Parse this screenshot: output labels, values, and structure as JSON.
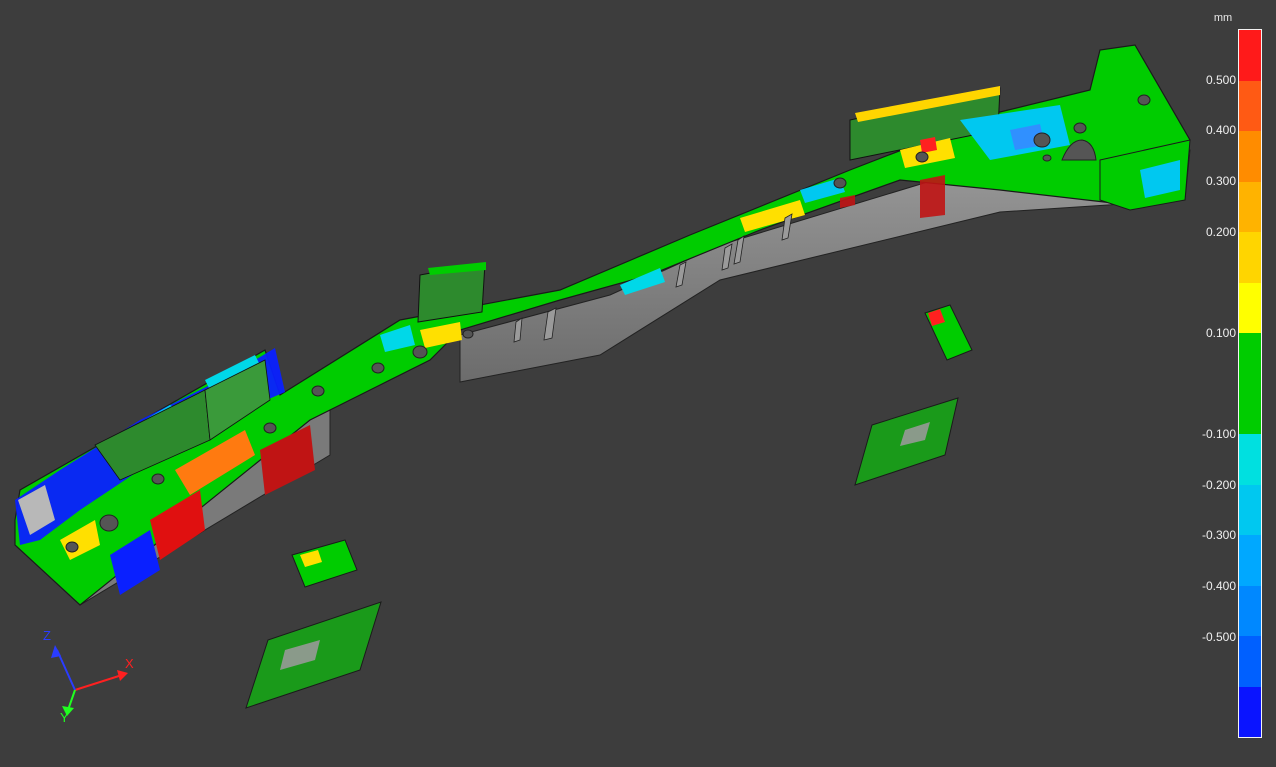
{
  "legend": {
    "unit": "mm",
    "labels": [
      "0.500",
      "0.400",
      "0.300",
      "0.200",
      "0.100",
      "-0.100",
      "-0.200",
      "-0.300",
      "-0.400",
      "-0.500"
    ],
    "bands": [
      {
        "color": "#ff1a1a"
      },
      {
        "color": "#ff5a14"
      },
      {
        "color": "#ff8c00"
      },
      {
        "color": "#ffb300"
      },
      {
        "color": "#ffd500"
      },
      {
        "color": "#ffff00"
      },
      {
        "color": "#00cc00",
        "weight": 2
      },
      {
        "color": "#00e0e0"
      },
      {
        "color": "#00c8f0"
      },
      {
        "color": "#00a8ff"
      },
      {
        "color": "#0088ff"
      },
      {
        "color": "#0060ff"
      },
      {
        "color": "#0a14ff"
      }
    ]
  },
  "axes": {
    "x_label": "X",
    "y_label": "Y",
    "z_label": "Z",
    "x_color": "#ff2020",
    "y_color": "#20ff20",
    "z_color": "#2a3cff"
  },
  "colors": {
    "background": "#3d3d3d",
    "in_tolerance": "#00cc00",
    "side_wall": "#8a8a8a"
  }
}
